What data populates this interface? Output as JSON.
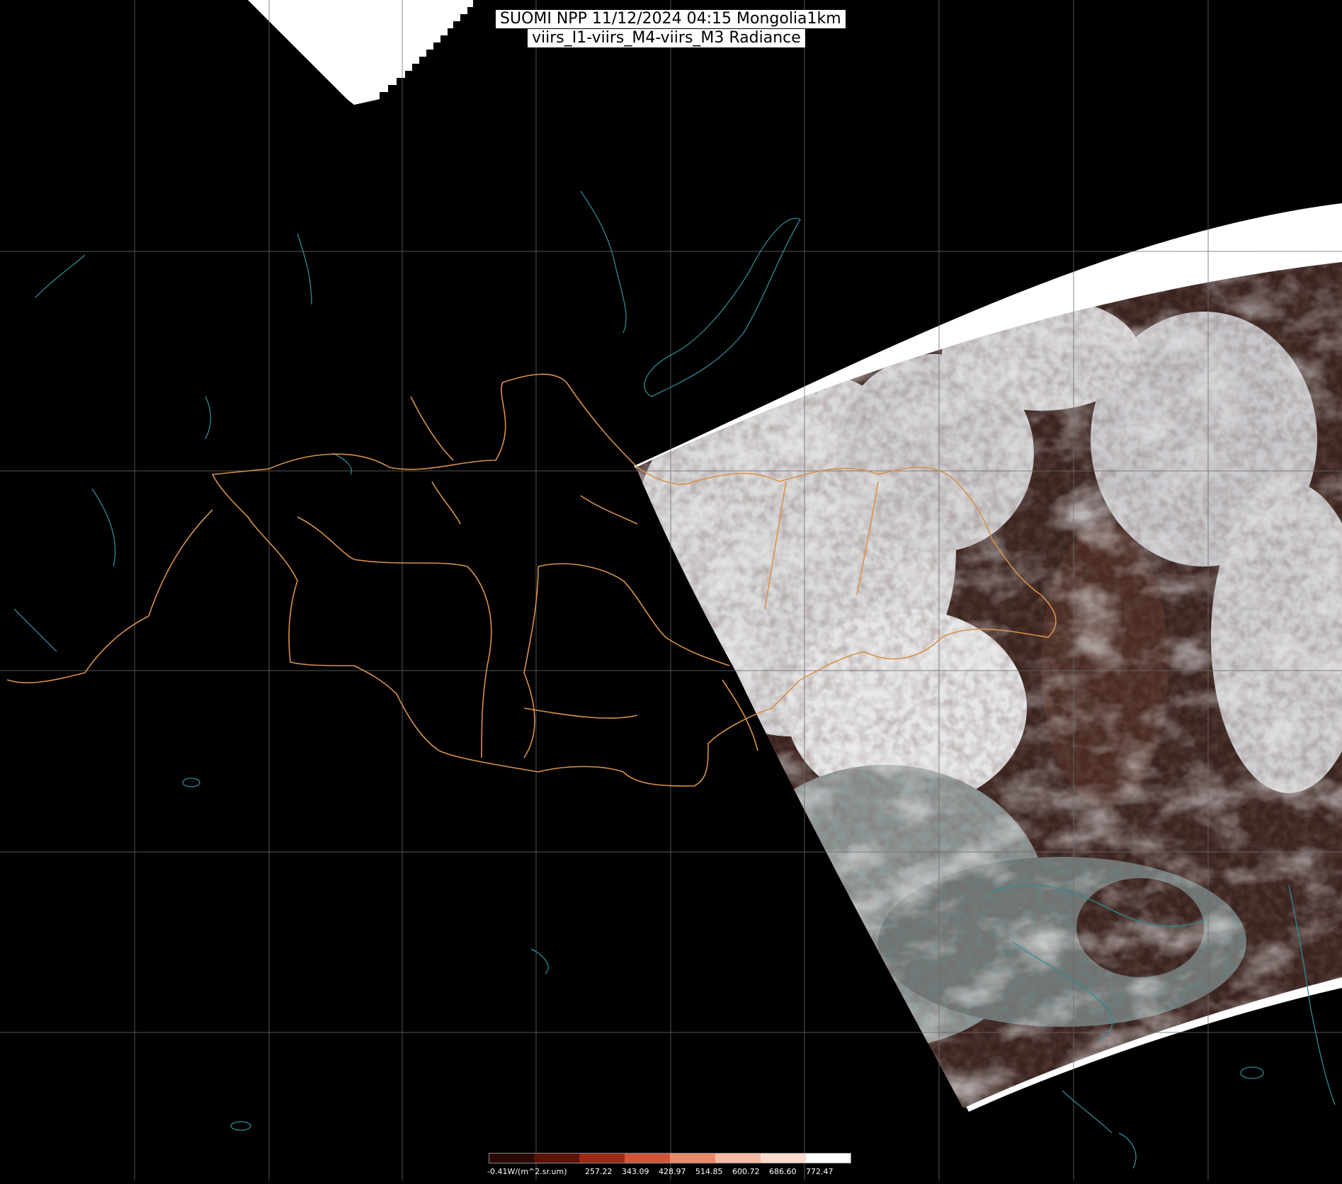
{
  "title": {
    "line1": "SUOMI NPP 11/12/2024 04:15 Mongolia1km",
    "line2": "viirs_I1-viirs_M4-viirs_M3 Radiance"
  },
  "colorbar": {
    "labels": [
      "-0.41W/(m^2.sr.um)",
      "257.22",
      "343.09",
      "428.97",
      "514.85",
      "600.72",
      "686.60",
      "772.47"
    ],
    "colors": [
      "#2a0a05",
      "#5c1208",
      "#9a2a14",
      "#d2553a",
      "#ec8a6c",
      "#f6b9a2",
      "#fbdcd0",
      "#ffffff"
    ]
  },
  "map": {
    "background_color": "#000000",
    "no_data_color": "#ffffff",
    "grid_color": "#6a6a6a",
    "coastline_color": "#2f8a94",
    "border_color": "#d8924a",
    "swath_colors": {
      "cloud": "#e6e6e8",
      "forest": "#3a2420",
      "snow": "#cfcfd2",
      "haze": "#8c9696"
    }
  }
}
